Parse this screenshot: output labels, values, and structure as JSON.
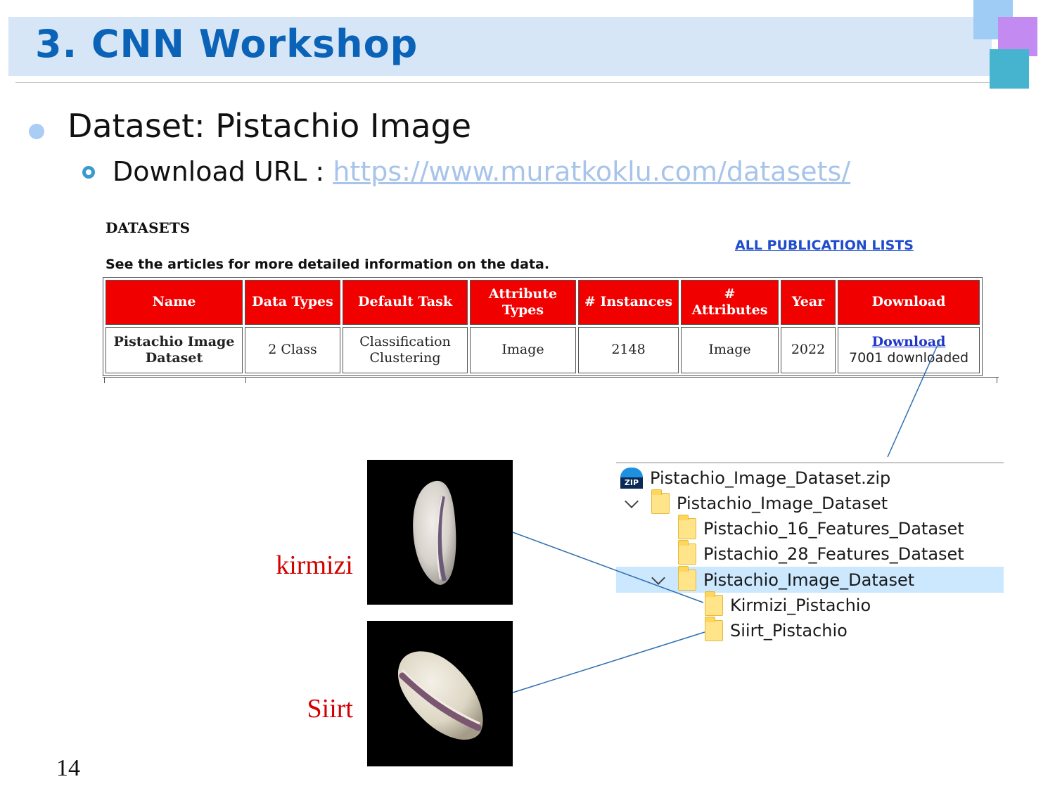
{
  "slide": {
    "title": "3. CNN Workshop",
    "bullet1": "Dataset: Pistachio Image",
    "bullet2_prefix": "Download URL : ",
    "bullet2_url": "https://www.muratkoklu.com/datasets/",
    "page_number": "14"
  },
  "website": {
    "heading": "DATASETS",
    "subtitle": "See the articles for more detailed information on the data.",
    "publication_link": "ALL PUBLICATION LISTS",
    "table": {
      "headers": [
        "Name",
        "Data Types",
        "Default Task",
        "Attribute Types",
        "# Instances",
        "# Attributes",
        "Year",
        "Download"
      ],
      "row": {
        "name": "Pistachio Image Dataset",
        "data_types": "2 Class",
        "default_task_1": "Classification",
        "default_task_2": "Clustering",
        "attribute_types": "Image",
        "instances": "2148",
        "attributes": "Image",
        "year": "2022",
        "download_link": "Download",
        "download_count": "7001 downloaded"
      }
    },
    "colors": {
      "header_bg": "#f10000",
      "link": "#1f36c9"
    }
  },
  "samples": {
    "label_1": "kirmizi",
    "label_2": "Siirt",
    "label_color": "#d40000"
  },
  "file_tree": {
    "items": [
      {
        "label": "Pistachio_Image_Dataset.zip",
        "icon": "zip-archive-icon"
      },
      {
        "label": "Pistachio_Image_Dataset",
        "icon": "folder-icon",
        "expanded": true
      },
      {
        "label": "Pistachio_16_Features_Dataset",
        "icon": "folder-icon"
      },
      {
        "label": "Pistachio_28_Features_Dataset",
        "icon": "folder-icon"
      },
      {
        "label": "Pistachio_Image_Dataset",
        "icon": "folder-icon",
        "expanded": true,
        "selected": true
      },
      {
        "label": "Kirmizi_Pistachio",
        "icon": "folder-icon"
      },
      {
        "label": "Siirt_Pistachio",
        "icon": "folder-icon"
      }
    ],
    "zip_badge": "ZIP"
  }
}
